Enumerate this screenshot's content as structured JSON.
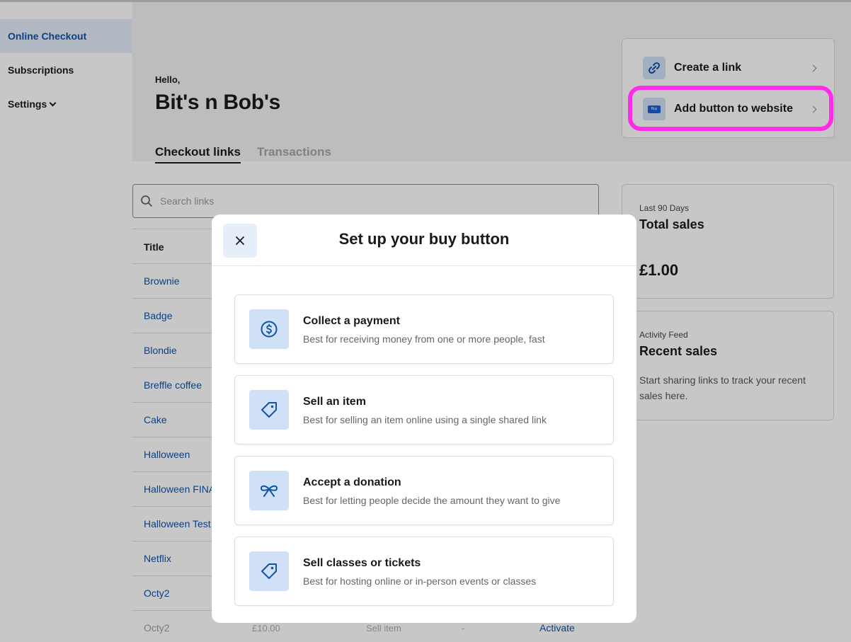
{
  "sidebar": {
    "items": [
      {
        "label": "Online Checkout"
      },
      {
        "label": "Subscriptions"
      },
      {
        "label": "Settings"
      }
    ]
  },
  "header": {
    "greeting": "Hello,",
    "business_name": "Bit's n Bob's",
    "tabs": [
      {
        "label": "Checkout links"
      },
      {
        "label": "Transactions"
      }
    ]
  },
  "actions": {
    "create_link": "Create a link",
    "add_button": "Add button to website",
    "add_button_icon_text": "Buy"
  },
  "search": {
    "placeholder": "Search links"
  },
  "table": {
    "title_header": "Title",
    "rows": [
      {
        "title": "Brownie"
      },
      {
        "title": "Badge"
      },
      {
        "title": "Blondie"
      },
      {
        "title": "Breffle coffee"
      },
      {
        "title": "Cake"
      },
      {
        "title": "Halloween"
      },
      {
        "title": "Halloween FINAL"
      },
      {
        "title": "Halloween Test"
      },
      {
        "title": "Netflix"
      },
      {
        "title": "Octy2"
      },
      {
        "title": "Octy2",
        "price": "£10.00",
        "type": "Sell item",
        "status": "-",
        "action": "Activate"
      }
    ]
  },
  "total_sales": {
    "period": "Last 90 Days",
    "title": "Total sales",
    "amount": "£1.00"
  },
  "recent_sales": {
    "label": "Activity Feed",
    "title": "Recent sales",
    "message": "Start sharing links to track your recent sales here."
  },
  "modal": {
    "title": "Set up your buy button",
    "options": [
      {
        "title": "Collect a payment",
        "description": "Best for receiving money from one or more people, fast",
        "icon": "dollar-coin-icon"
      },
      {
        "title": "Sell an item",
        "description": "Best for selling an item online using a single shared link",
        "icon": "tag-icon"
      },
      {
        "title": "Accept a donation",
        "description": "Best for letting people decide the amount they want to give",
        "icon": "ribbon-icon"
      },
      {
        "title": "Sell classes or tickets",
        "description": "Best for hosting online or in-person events or classes",
        "icon": "ticket-tag-icon"
      }
    ]
  },
  "colors": {
    "accent": "#0f53a8",
    "icon_bg": "#cfe0f7",
    "highlight": "#ff2de6"
  }
}
